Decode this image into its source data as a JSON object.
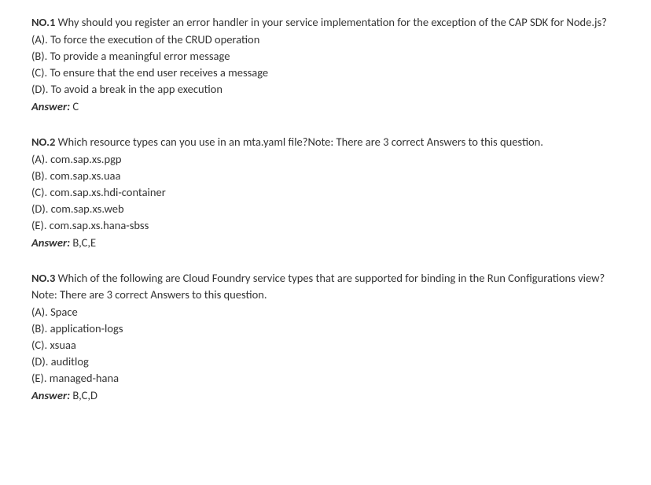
{
  "questions": [
    {
      "number": "NO.1",
      "text": "Why should you register an error handler in your service implementation for the exception of the CAP SDK for Node.js?",
      "options": [
        "(A). To force the execution of the CRUD operation",
        "(B). To provide a meaningful error message",
        "(C). To ensure that the end user receives a message",
        "(D). To avoid a break in the app execution"
      ],
      "answer_label": "Answer:",
      "answer": "C"
    },
    {
      "number": "NO.2",
      "text": "Which resource types can you use in an mta.yaml file?Note: There are 3 correct Answers to this question.",
      "options": [
        "(A). com.sap.xs.pgp",
        "(B). com.sap.xs.uaa",
        "(C). com.sap.xs.hdi-container",
        "(D). com.sap.xs.web",
        "(E). com.sap.xs.hana-sbss"
      ],
      "answer_label": "Answer:",
      "answer": "B,C,E"
    },
    {
      "number": "NO.3",
      "text": "Which of the following are Cloud Foundry service types that are supported for binding in the Run Configurations view?Note: There are 3 correct Answers to this question.",
      "options": [
        "(A). Space",
        "(B). application-logs",
        "(C). xsuaa",
        "(D). auditlog",
        "(E). managed-hana"
      ],
      "answer_label": "Answer:",
      "answer": "B,C,D"
    }
  ]
}
